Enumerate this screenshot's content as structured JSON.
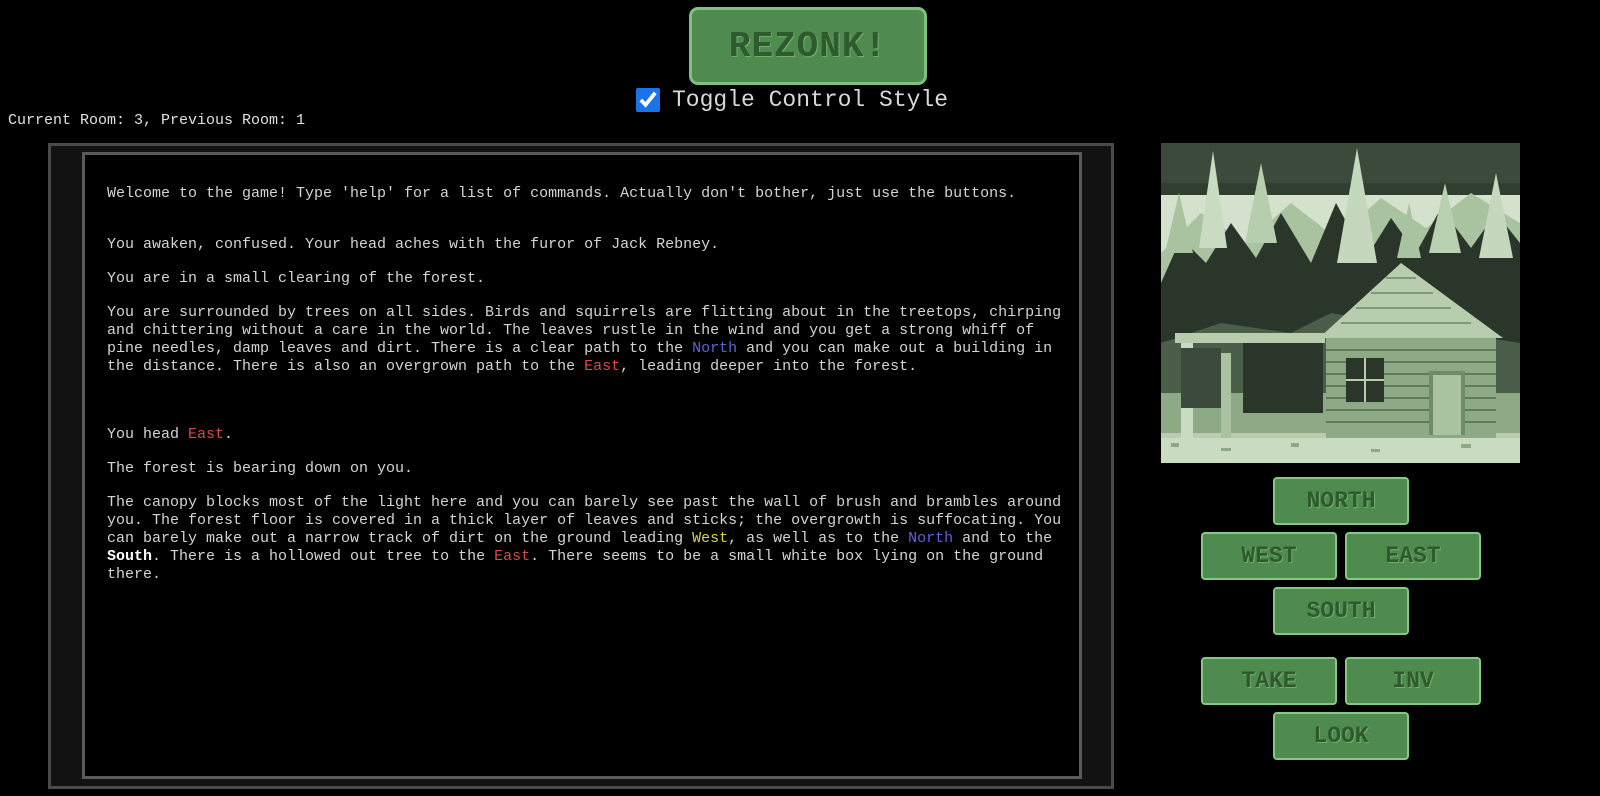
{
  "header": {
    "title_button": "REZONK!",
    "toggle_label": "Toggle Control Style",
    "toggle_checked": true
  },
  "status": {
    "room_text": "Current Room: 3, Previous Room: 1"
  },
  "console": {
    "intro": "Welcome to the game! Type 'help' for a list of commands. Actually don't bother, just use the buttons.",
    "room1": {
      "awaken": "You awaken, confused. Your head aches with the furor of Jack Rebney.",
      "location": "You are in a small clearing of the forest.",
      "desc_1": "You are surrounded by trees on all sides. Birds and squirrels are flitting about in the treetops, chirping and chittering without a care in the world. The leaves rustle in the wind and you get a strong whiff of pine needles, damp leaves and dirt. There is a clear path to the ",
      "desc_north": "North",
      "desc_2": " and you can make out a building in the distance. There is also an overgrown path to the ",
      "desc_east": "East",
      "desc_3": ", leading deeper into the forest."
    },
    "move": {
      "prefix": "You head ",
      "dir": "East",
      "suffix": "."
    },
    "room3": {
      "location": "The forest is bearing down on you.",
      "desc_1": "The canopy blocks most of the light here and you can barely see past the wall of brush and brambles around you. The forest floor is covered in a thick layer of leaves and sticks; the overgrowth is suffocating. You can barely make out a narrow track of dirt on the ground leading ",
      "desc_west": "West",
      "desc_2": ", as well as to the ",
      "desc_north": "North",
      "desc_3": " and to the ",
      "desc_south": "South",
      "desc_4": ". There is a hollowed out tree to the ",
      "desc_east": "East",
      "desc_5": ". There seems to be a small white box lying on the ground there."
    }
  },
  "controls": {
    "north": "NORTH",
    "west": "WEST",
    "east": "EAST",
    "south": "SOUTH",
    "take": "TAKE",
    "inv": "INV",
    "look": "LOOK"
  },
  "colors": {
    "button_bg": "#4f8a4f",
    "button_text": "#2e5a2e",
    "north": "#5f63d8",
    "east": "#d84a4a",
    "west": "#d8d44a",
    "south": "#ffffff"
  }
}
